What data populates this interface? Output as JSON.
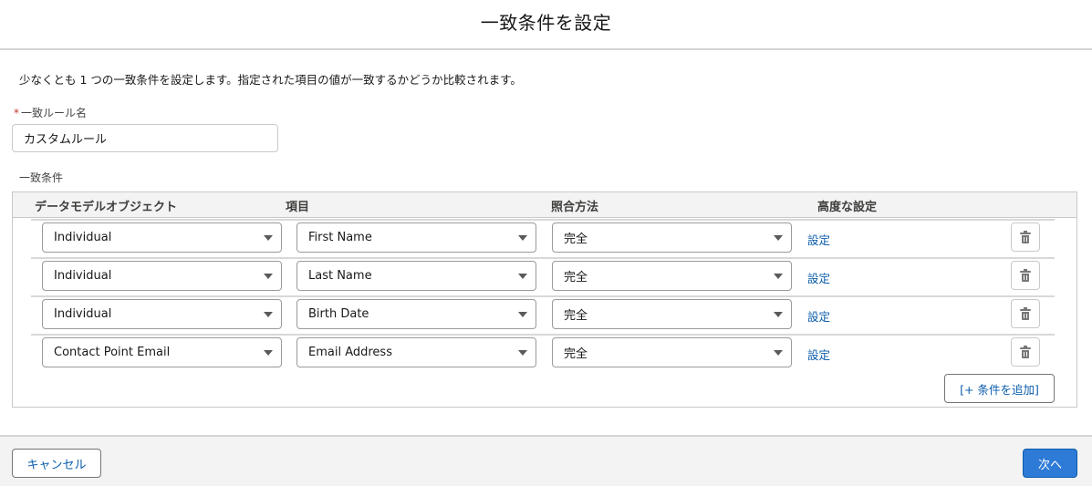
{
  "header": {
    "title": "一致条件を設定"
  },
  "intro": "少なくとも 1 つの一致条件を設定します。指定された項目の値が一致するかどうか比較されます。",
  "rule_name": {
    "required_mark": "*",
    "label": "一致ルール名",
    "value": "カスタムルール"
  },
  "conditions": {
    "label": "一致条件",
    "columns": [
      "データモデルオブジェクト",
      "項目",
      "照合方法",
      "高度な設定"
    ],
    "rows": [
      {
        "object": "Individual",
        "field": "First Name",
        "method": "完全",
        "settings_link": "設定"
      },
      {
        "object": "Individual",
        "field": "Last Name",
        "method": "完全",
        "settings_link": "設定"
      },
      {
        "object": "Individual",
        "field": "Birth Date",
        "method": "完全",
        "settings_link": "設定"
      },
      {
        "object": "Contact Point Email",
        "field": "Email Address",
        "method": "完全",
        "settings_link": "設定"
      }
    ],
    "add_button": "[+ 条件を追加]"
  },
  "footer": {
    "cancel": "キャンセル",
    "next": "次へ"
  },
  "colors": {
    "link": "#0b5cab",
    "primary": "#2e7bd7",
    "required": "#c23934"
  }
}
